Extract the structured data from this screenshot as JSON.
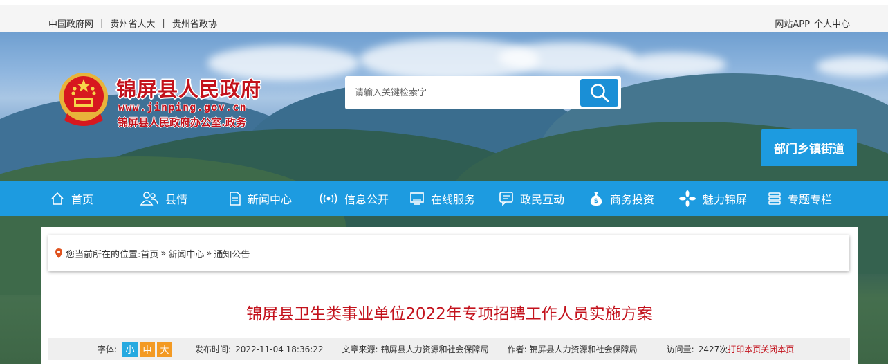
{
  "topbar": {
    "links": [
      "中国政府网",
      "贵州省人大",
      "贵州省政协"
    ],
    "separator": "|",
    "right": [
      "网站APP",
      "个人中心"
    ]
  },
  "logo": {
    "name": "锦屏县人民政府",
    "url": "www.jinping.gov.cn",
    "subtitle": "锦屏县人民政府办公室.政务"
  },
  "search": {
    "placeholder": "请输入关键检索字",
    "button_icon": "search-icon"
  },
  "dept_button": "部门乡镇街道",
  "nav": {
    "items": [
      {
        "label": "首页",
        "icon": "home-icon"
      },
      {
        "label": "县情",
        "icon": "people-icon"
      },
      {
        "label": "新闻中心",
        "icon": "document-icon"
      },
      {
        "label": "信息公开",
        "icon": "broadcast-icon"
      },
      {
        "label": "在线服务",
        "icon": "monitor-icon"
      },
      {
        "label": "政民互动",
        "icon": "chat-icon"
      },
      {
        "label": "商务投资",
        "icon": "money-bag-icon"
      },
      {
        "label": "魅力锦屏",
        "icon": "flower-icon"
      },
      {
        "label": "专题专栏",
        "icon": "list-icon"
      }
    ]
  },
  "breadcrumb": {
    "prefix": "您当前所在的位置:",
    "items": [
      "首页",
      "新闻中心",
      "通知公告"
    ],
    "arrow": "»",
    "icon": "location-pin-icon"
  },
  "article": {
    "title": "锦屏县卫生类事业单位2022年专项招聘工作人员实施方案",
    "font_label": "字体:",
    "font_sizes": [
      "小",
      "中",
      "大"
    ],
    "publish_label": "发布时间:",
    "publish_time": "2022-11-04 18:36:22",
    "source_label": "文章来源:",
    "source": "锦屏县人力资源和社会保障局",
    "author_label": "作者:",
    "author": "锦屏县人力资源和社会保障局",
    "visits_label": "访问量:",
    "visits": "2427次",
    "print_label": "打印本页",
    "close_label": "关闭本页"
  },
  "colors": {
    "nav_blue": "#1d9be0",
    "title_red": "#c3121c",
    "font_small": "#26a9e0",
    "font_mid_large": "#f39a24"
  }
}
